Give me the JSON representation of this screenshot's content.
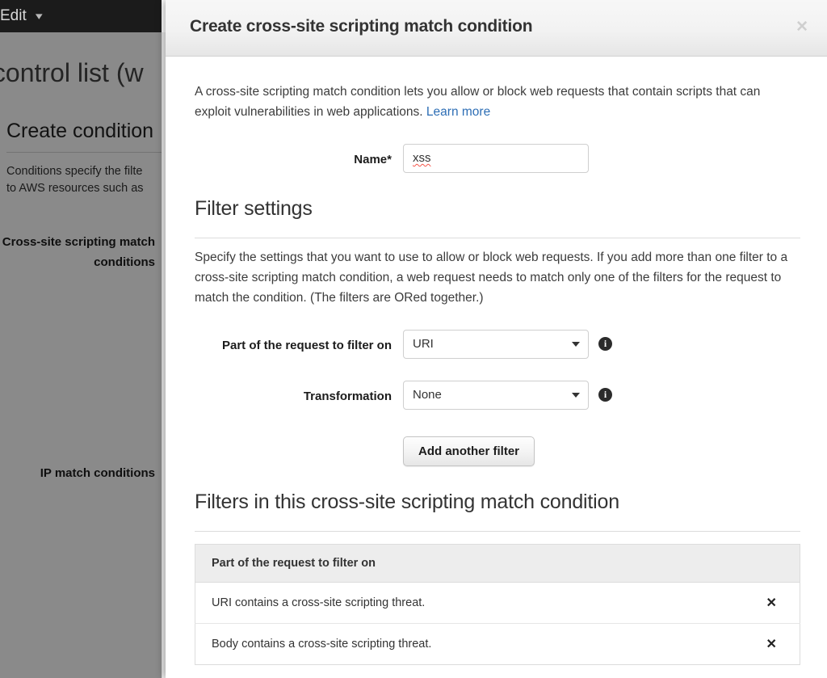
{
  "background": {
    "navbar": {
      "edit_label": "Edit",
      "caret_icon": "chevron-down-icon"
    },
    "page_title": "s control list (w",
    "section_heading": "Create condition",
    "paragraph_line1": "Conditions specify the filte",
    "paragraph_line2": "to AWS resources such as",
    "label_xss": "Cross-site scripting match conditions",
    "label_ip": "IP match conditions"
  },
  "modal": {
    "title": "Create cross-site scripting match condition",
    "close_icon": "close-icon",
    "intro": {
      "text": "A cross-site scripting match condition lets you allow or block web requests that contain scripts that can exploit vulnerabilities in web applications. ",
      "link_label": "Learn more"
    },
    "name_field": {
      "label": "Name*",
      "value": "xss",
      "placeholder": ""
    },
    "filter_settings": {
      "heading": "Filter settings",
      "description": "Specify the settings that you want to use to allow or block web requests. If you add more than one filter to a cross-site scripting match condition, a web request needs to match only one of the filters for the request to match the condition. (The filters are ORed together.)",
      "part_of_request": {
        "label": "Part of the request to filter on",
        "value": "URI",
        "info_icon": "info-icon",
        "caret_icon": "caret-down-icon"
      },
      "transformation": {
        "label": "Transformation",
        "value": "None",
        "info_icon": "info-icon",
        "caret_icon": "caret-down-icon"
      },
      "add_filter_button": "Add another filter"
    },
    "filters_list": {
      "heading": "Filters in this cross-site scripting match condition",
      "column_header": "Part of the request to filter on",
      "delete_icon": "✕",
      "rows": [
        {
          "description": "URI contains a cross-site scripting threat."
        },
        {
          "description": "Body contains a cross-site scripting threat."
        }
      ]
    }
  },
  "colors": {
    "link": "#2d6eb5",
    "header_bg": "#f2f2f2",
    "table_header_bg": "#ededed",
    "spellcheck_underline": "#f4564a"
  }
}
